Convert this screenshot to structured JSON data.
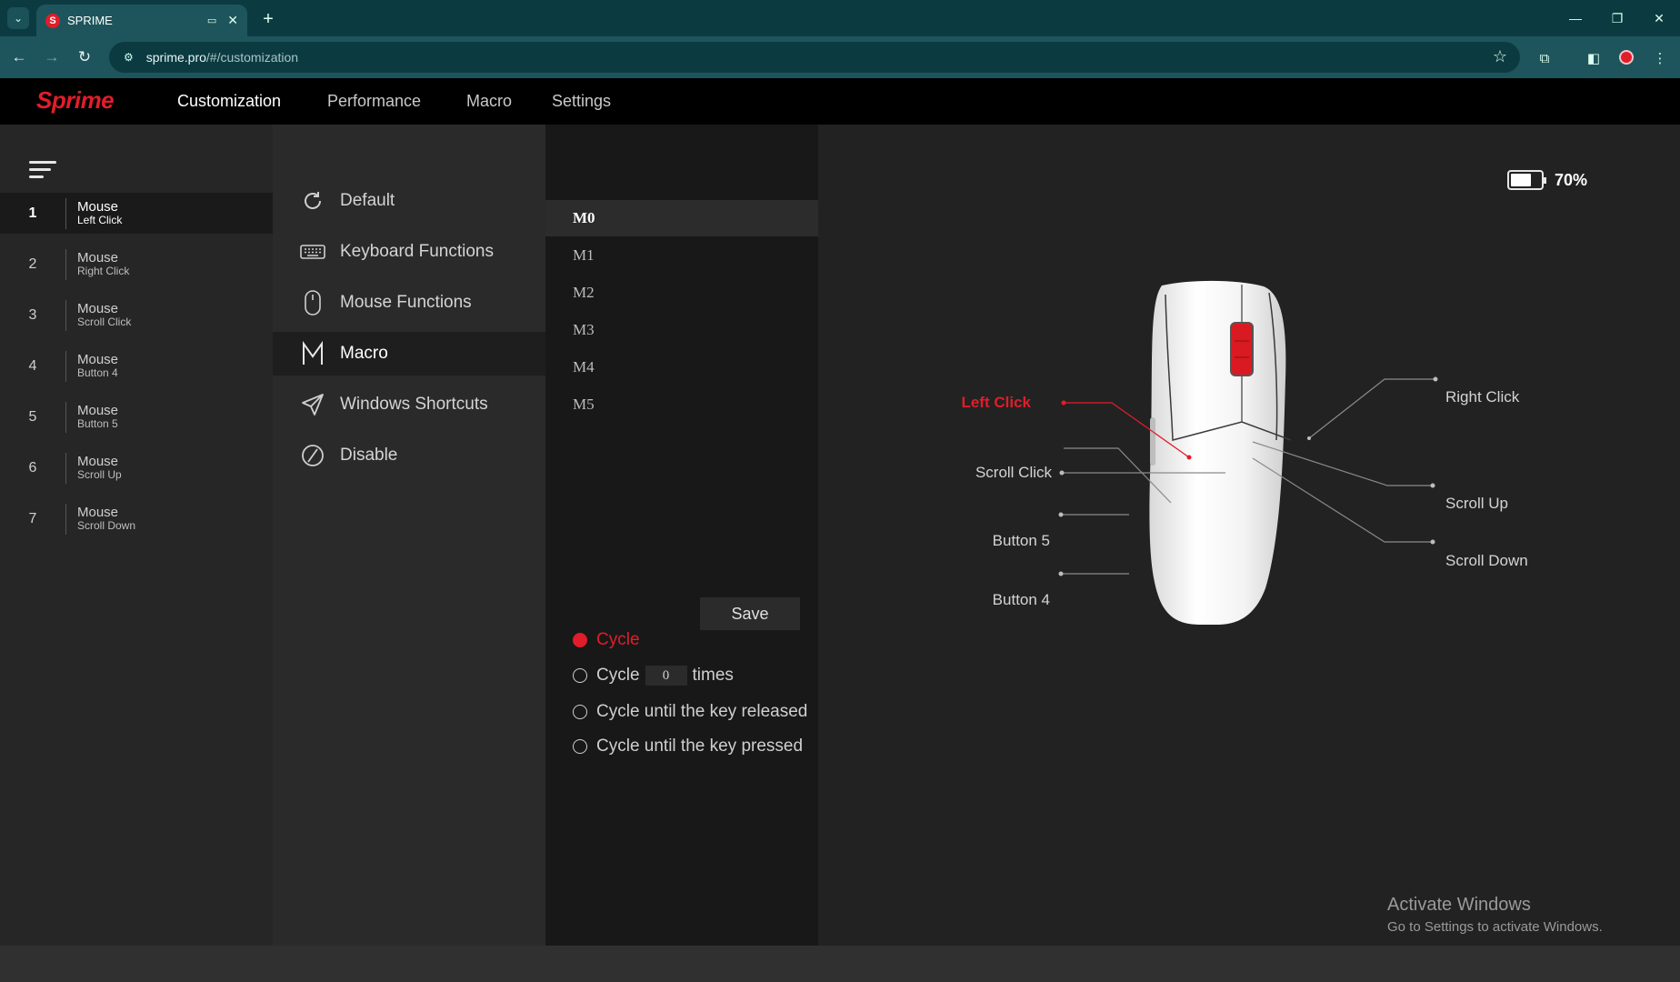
{
  "browser": {
    "tab_title": "SPRIME",
    "url_host": "sprime.pro",
    "url_path": "/#/customization"
  },
  "app": {
    "logo": "Sprime",
    "nav": [
      "Customization",
      "Performance",
      "Macro",
      "Settings"
    ],
    "active_nav": "Customization"
  },
  "buttons": [
    {
      "num": "1",
      "main": "Mouse",
      "sub": "Left Click"
    },
    {
      "num": "2",
      "main": "Mouse",
      "sub": "Right Click"
    },
    {
      "num": "3",
      "main": "Mouse",
      "sub": "Scroll Click"
    },
    {
      "num": "4",
      "main": "Mouse",
      "sub": "Button 4"
    },
    {
      "num": "5",
      "main": "Mouse",
      "sub": "Button 5"
    },
    {
      "num": "6",
      "main": "Mouse",
      "sub": "Scroll Up"
    },
    {
      "num": "7",
      "main": "Mouse",
      "sub": "Scroll Down"
    }
  ],
  "functions": [
    {
      "label": "Default",
      "icon": "refresh-icon"
    },
    {
      "label": "Keyboard Functions",
      "icon": "keyboard-icon"
    },
    {
      "label": "Mouse Functions",
      "icon": "mouse-icon"
    },
    {
      "label": "Macro",
      "icon": "macro-m-icon"
    },
    {
      "label": "Windows Shortcuts",
      "icon": "send-icon"
    },
    {
      "label": "Disable",
      "icon": "disable-icon"
    }
  ],
  "macros": [
    "M0",
    "M1",
    "M2",
    "M3",
    "M4",
    "M5"
  ],
  "macro_panel": {
    "save_label": "Save",
    "options": {
      "cycle": "Cycle",
      "cycle_times_prefix": "Cycle",
      "cycle_times_value": "0",
      "cycle_times_suffix": "times",
      "until_released": "Cycle until the key released",
      "until_pressed": "Cycle until the key pressed"
    }
  },
  "battery": {
    "percent_label": "70%",
    "level": 0.7
  },
  "diagram_labels": {
    "left_click": "Left Click",
    "right_click": "Right Click",
    "scroll_click": "Scroll Click",
    "scroll_up": "Scroll Up",
    "button5": "Button 5",
    "scroll_down": "Scroll Down",
    "button4": "Button 4"
  },
  "colors": {
    "accent": "#e11d2a",
    "line": "#8a8a8a"
  },
  "watermark": {
    "title": "Activate Windows",
    "subtitle": "Go to Settings to activate Windows."
  }
}
